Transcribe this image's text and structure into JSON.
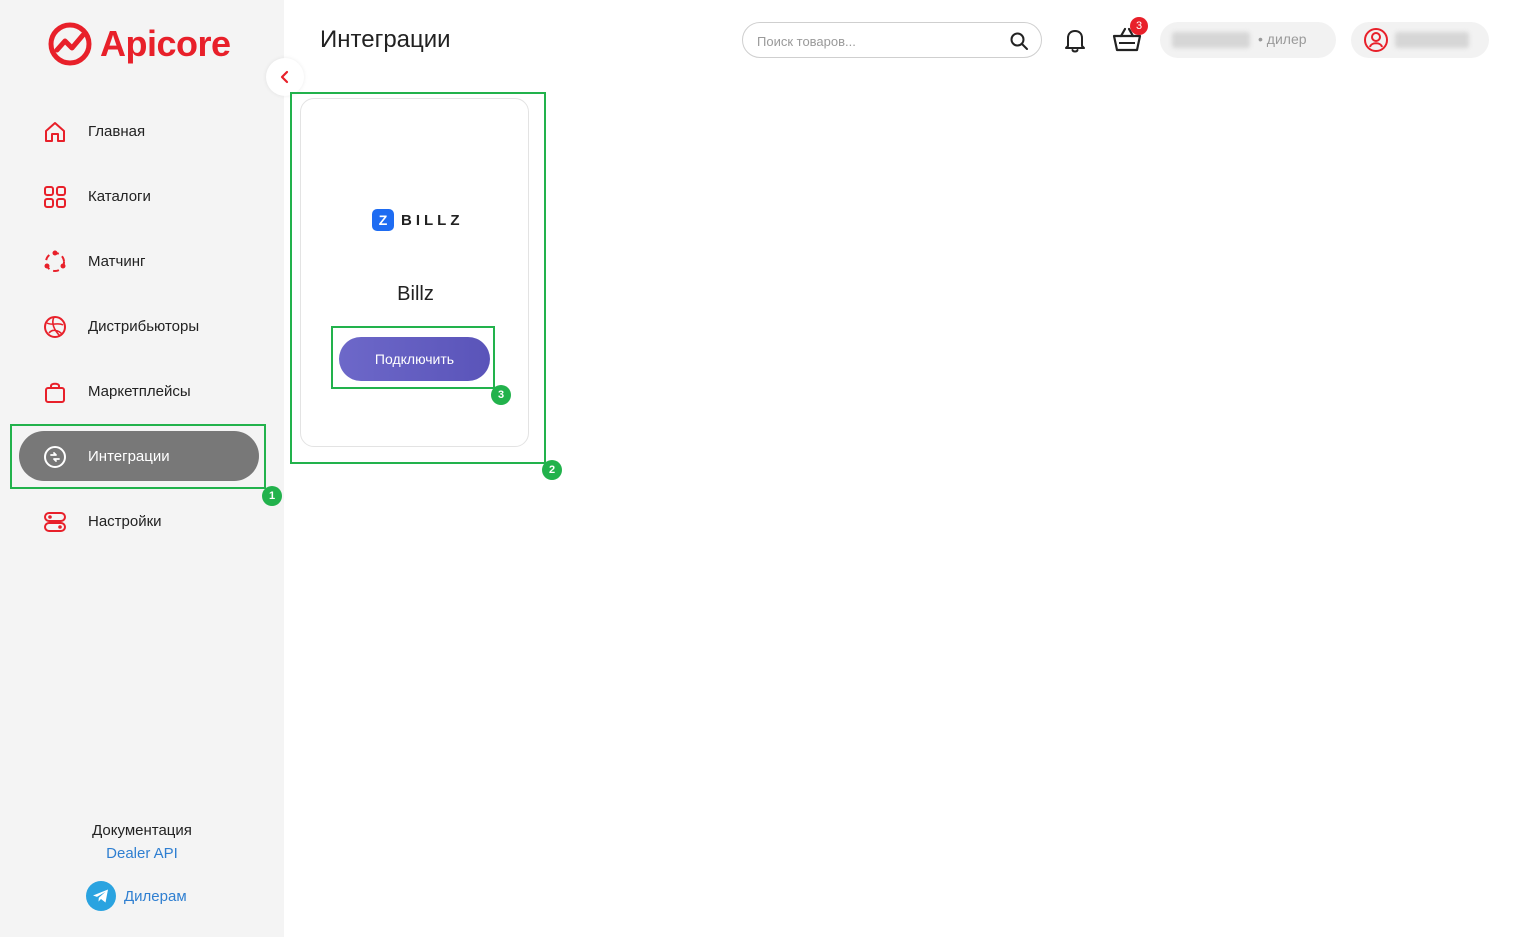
{
  "app": {
    "brand": "Apicore",
    "accent_color": "#e8202a"
  },
  "header": {
    "title": "Интеграции",
    "search": {
      "placeholder": "Поиск товаров..."
    },
    "cart_count": "3",
    "dealer_role": "дилер"
  },
  "sidebar": {
    "items": [
      {
        "label": "Главная",
        "icon": "home-icon"
      },
      {
        "label": "Каталоги",
        "icon": "catalog-grid-icon"
      },
      {
        "label": "Матчинг",
        "icon": "matching-icon"
      },
      {
        "label": "Дистрибьюторы",
        "icon": "globe-icon"
      },
      {
        "label": "Маркетплейсы",
        "icon": "shopping-bag-icon"
      },
      {
        "label": "Интеграции",
        "icon": "integration-icon",
        "active": true
      },
      {
        "label": "Настройки",
        "icon": "settings-toggle-icon"
      }
    ],
    "footer": {
      "doc_title": "Документация",
      "doc_link": "Dealer API",
      "telegram_label": "Дилерам"
    }
  },
  "integrations": [
    {
      "name": "Billz",
      "logo_letter": "Z",
      "logo_text": "BILLZ",
      "button_label": "Подключить"
    }
  ],
  "annotations": [
    {
      "number": "1"
    },
    {
      "number": "2"
    },
    {
      "number": "3"
    }
  ]
}
